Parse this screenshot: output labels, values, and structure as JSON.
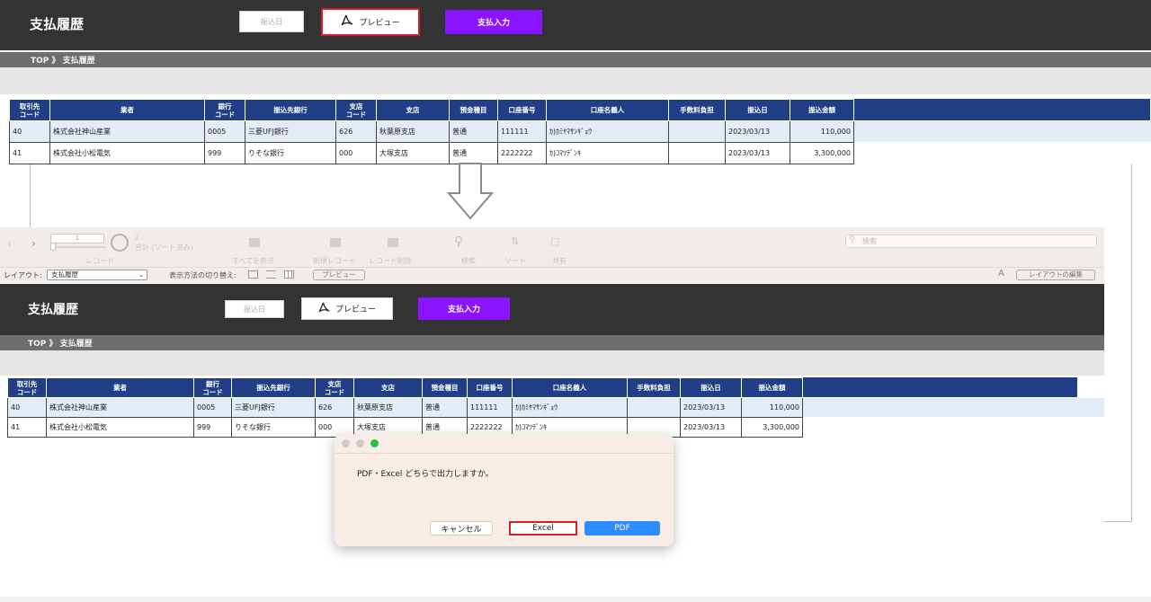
{
  "top_screen": {
    "title": "支払履歴",
    "date_button": "振込日",
    "preview_button": "プレビュー",
    "pay_button": "支払入力",
    "breadcrumb": "TOP 》 支払履歴"
  },
  "table": {
    "headers": [
      "取引先\nコード",
      "業者",
      "銀行\nコード",
      "振込先銀行",
      "支店\nコード",
      "支店",
      "預金種目",
      "口座番号",
      "口座名義人",
      "手数料負担",
      "振込日",
      "振込金額"
    ],
    "rows": [
      [
        "40",
        "株式会社神山産業",
        "0005",
        "三菱UFJ銀行",
        "626",
        "秋葉原支店",
        "普通",
        "111111",
        "ｶ)ｶﾐﾔﾏｻﾝｷﾞｮｳ",
        "",
        "2023/03/13",
        "110,000"
      ],
      [
        "41",
        "株式会社小松電気",
        "999",
        "りそな銀行",
        "000",
        "大塚支店",
        "普通",
        "2222222",
        "ｶ)ｺﾏﾂﾃﾞﾝｷ",
        "",
        "2023/03/13",
        "3,300,000"
      ]
    ]
  },
  "toolbar": {
    "record_value": "1",
    "total_count": "2",
    "total_label": "合計 (ソート済み)",
    "records_label": "レコード",
    "show_all": "すべてを表示",
    "new_record": "新規レコード",
    "delete_record": "レコード削除",
    "find": "検索",
    "sort": "ソート",
    "share": "共有",
    "search_placeholder": "検索",
    "layout_label": "レイアウト:",
    "layout_value": "支払履歴",
    "view_as_label": "表示方法の切り替え:",
    "preview_label": "プレビュー",
    "edit_layout": "レイアウトの編集",
    "font_size_icon": "A"
  },
  "dialog": {
    "message": "PDF・Excel どちらで出力しますか。",
    "cancel": "キャンセル",
    "excel": "Excel",
    "pdf": "PDF"
  },
  "colors": {
    "header_bg": "#333333",
    "table_header": "#213f86",
    "pay_button": "#8a14ff",
    "highlight_border": "#d81e2a",
    "pdf_button": "#2d8cff"
  }
}
